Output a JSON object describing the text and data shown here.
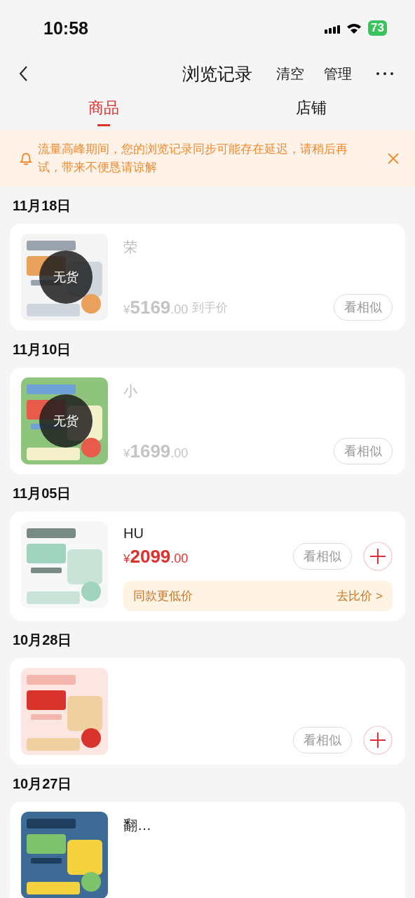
{
  "status_bar": {
    "time": "10:58",
    "battery": "73"
  },
  "nav_bar": {
    "title": "浏览记录",
    "actions": [
      "清空",
      "管理"
    ]
  },
  "tabs": [
    {
      "label": "商品",
      "selected": true
    },
    {
      "label": "店铺",
      "selected": false
    }
  ],
  "notice": {
    "text": "流量高峰期间，您的浏览记录同步可能存在延迟，请稍后再试，带来不便恳请谅解"
  },
  "groups": [
    {
      "date": "11月18日",
      "items": [
        {
          "out_of_stock": true,
          "stock_label": "无货",
          "title": "荣",
          "price": {
            "currency": "¥",
            "integer": "5169",
            "decimals": ".00",
            "suffix": "到手价"
          },
          "similar_button": "看相似",
          "add_button": false
        }
      ]
    },
    {
      "date": "11月10日",
      "items": [
        {
          "out_of_stock": true,
          "stock_label": "无货",
          "title": "小",
          "price": {
            "currency": "¥",
            "integer": "1699",
            "decimals": ".00"
          },
          "similar_button": "看相似",
          "add_button": false
        }
      ]
    },
    {
      "date": "11月05日",
      "items": [
        {
          "out_of_stock": false,
          "title": "HU",
          "price": {
            "currency": "¥",
            "integer": "2099",
            "decimals": ".00"
          },
          "similar_button": "看相似",
          "add_button": true,
          "compare": {
            "label": "同款更低价",
            "action": "去比价 >"
          }
        }
      ]
    },
    {
      "date": "10月28日",
      "items": [
        {
          "out_of_stock": false,
          "similar_button": "看相似",
          "add_button": true
        }
      ]
    },
    {
      "date": "10月27日",
      "items": [
        {
          "out_of_stock": false,
          "title": "翻…"
        }
      ]
    }
  ]
}
